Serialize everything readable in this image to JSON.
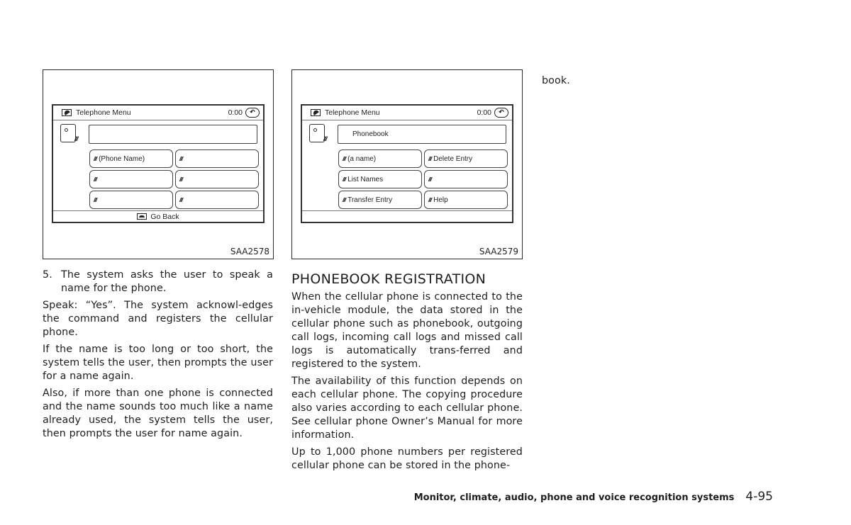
{
  "figures": [
    {
      "code": "SAA2578",
      "screen": {
        "title": "Telephone Menu",
        "time": "0:00",
        "input_text": "",
        "buttons": [
          "(Phone Name)",
          "",
          "",
          "",
          "",
          ""
        ],
        "footer_label": "Go Back"
      }
    },
    {
      "code": "SAA2579",
      "screen": {
        "title": "Telephone Menu",
        "time": "0:00",
        "input_text": "Phonebook",
        "buttons": [
          "(a name)",
          "Delete Entry",
          "List Names",
          "",
          "Transfer Entry",
          "Help"
        ],
        "footer_label": ""
      }
    }
  ],
  "icons": {
    "voice_marker": "///"
  },
  "column1": {
    "step_number": "5.",
    "step_text": "The system asks the user to speak a name for the phone.",
    "step_sub": "Speak: “Yes”. The system acknowl-edges the command and registers the cellular phone.",
    "para1": "If the name is too long or too short, the system tells the user, then prompts the user for a name again.",
    "para2": "Also, if more than one phone is connected and the name sounds too much like a name already used, the system tells the user, then prompts the user for name again."
  },
  "column2": {
    "heading": "PHONEBOOK REGISTRATION",
    "para1": "When the cellular phone is connected to the in-vehicle module, the data stored in the cellular phone such as phonebook, outgoing call logs, incoming call logs and missed call logs is automatically trans-ferred and registered to the system.",
    "para2": "The availability of this function depends on each cellular phone. The copying procedure also varies according to each cellular phone. See cellular phone Owner’s Manual for more information.",
    "para3": "Up to 1,000 phone numbers per registered cellular phone can be stored in the phone-"
  },
  "column3": {
    "para1": "book."
  },
  "footer": {
    "section_title": "Monitor, climate, audio, phone and voice recognition systems",
    "page_number": "4-95"
  }
}
